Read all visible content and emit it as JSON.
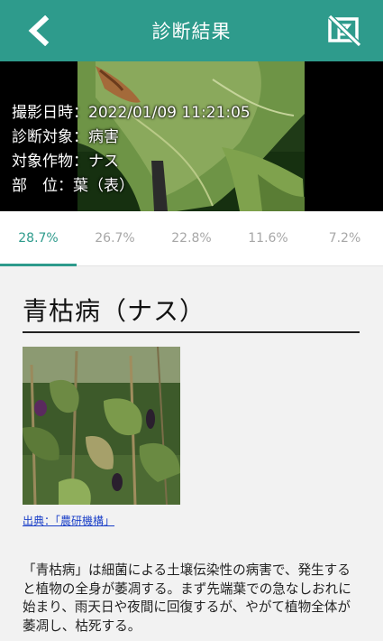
{
  "header": {
    "title": "診断結果"
  },
  "photo_meta": {
    "date_label": "撮影日時",
    "date_value": "2022/01/09 11:21:05",
    "target_label": "診断対象",
    "target_value": "病害",
    "crop_label": "対象作物",
    "crop_value": "ナス",
    "part_label": "部　位",
    "part_value": "葉（表）",
    "separator": "："
  },
  "tabs": [
    {
      "label": "28.7%",
      "active": true
    },
    {
      "label": "26.7%"
    },
    {
      "label": "22.8%"
    },
    {
      "label": "11.6%"
    },
    {
      "label": "7.2%"
    }
  ],
  "result": {
    "title": "青枯病（ナス）",
    "source_link": "出典：「農研機構」",
    "description": "「青枯病」は細菌による土壌伝染性の病害で、発生すると植物の全身が萎凋する。まず先端葉での急なしおれに始まり、雨天日や夜間に回復するが、やがて植物全体が萎凋し、枯死する。"
  },
  "colors": {
    "accent": "#2e9b8c",
    "link": "#1a3fc8"
  },
  "icons": {
    "back": "chevron-left-icon",
    "report": "flag-crossed-icon"
  }
}
